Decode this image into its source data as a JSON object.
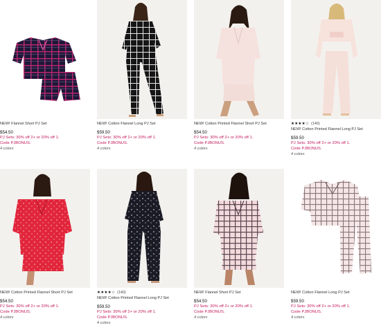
{
  "products": [
    {
      "name": "NEW! Flannel Short PJ Set",
      "price": "$54.50",
      "rating": null,
      "review_count": null,
      "promo_line1": "PJ Sets: 30% off 2+ or 20% off 1.",
      "promo_line2": "Code PJBONUS.",
      "colors": "4 colors"
    },
    {
      "name": "NEW! Cotton Flannel Long PJ Set",
      "price": "$59.50",
      "rating": null,
      "review_count": null,
      "promo_line1": "PJ Sets: 30% off 2+ or 20% off 1.",
      "promo_line2": "Code PJBONUS.",
      "colors": "4 colors"
    },
    {
      "name": "NEW! Cotton Printed Flannel Short PJ Set",
      "price": "$54.50",
      "rating": null,
      "review_count": null,
      "promo_line1": "PJ Sets: 30% off 2+ or 20% off 1.",
      "promo_line2": "Code PJBONUS.",
      "colors": "4 colors"
    },
    {
      "name": "NEW! Cotton Printed Flannel Long PJ Set",
      "price": "$59.50",
      "rating": "★★★★☆",
      "review_count": "(140)",
      "promo_line1": "PJ Sets: 30% off 2+ or 20% off 1.",
      "promo_line2": "Code PJBONUS.",
      "colors": "4 colors"
    },
    {
      "name": "NEW! Cotton Printed Flannel Short PJ Set",
      "price": "$54.50",
      "rating": null,
      "review_count": null,
      "promo_line1": "PJ Sets: 30% off 2+ or 20% off 1.",
      "promo_line2": "Code PJBONUS.",
      "colors": "4 colors"
    },
    {
      "name": "NEW! Cotton Printed Flannel Long PJ Set",
      "price": "$59.50",
      "rating": "★★★★☆",
      "review_count": "(140)",
      "promo_line1": "PJ Sets: 30% off 2+ or 20% off 1.",
      "promo_line2": "Code PJBONUS.",
      "colors": "4 colors"
    },
    {
      "name": "NEW! Flannel Short PJ Set",
      "price": "$54.50",
      "rating": null,
      "review_count": null,
      "promo_line1": "PJ Sets: 30% off 2+ or 20% off 1.",
      "promo_line2": "Code PJBONUS.",
      "colors": "4 colors"
    },
    {
      "name": "NEW! Cotton Flannel Long PJ Set",
      "price": "$59.50",
      "rating": null,
      "review_count": null,
      "promo_line1": "PJ Sets: 30% off 2+ or 20% off 1.",
      "promo_line2": "Code PJBONUS.",
      "colors": "4 colors"
    }
  ],
  "colors": {
    "promo": "#c2185b",
    "background": "#ffffff",
    "image_bg": "#f3f1ee",
    "navy_plaid": "#1d1838",
    "pink_check": "#f2d9db",
    "red_print": "#e1263b",
    "blush": "#f4dcd6"
  }
}
